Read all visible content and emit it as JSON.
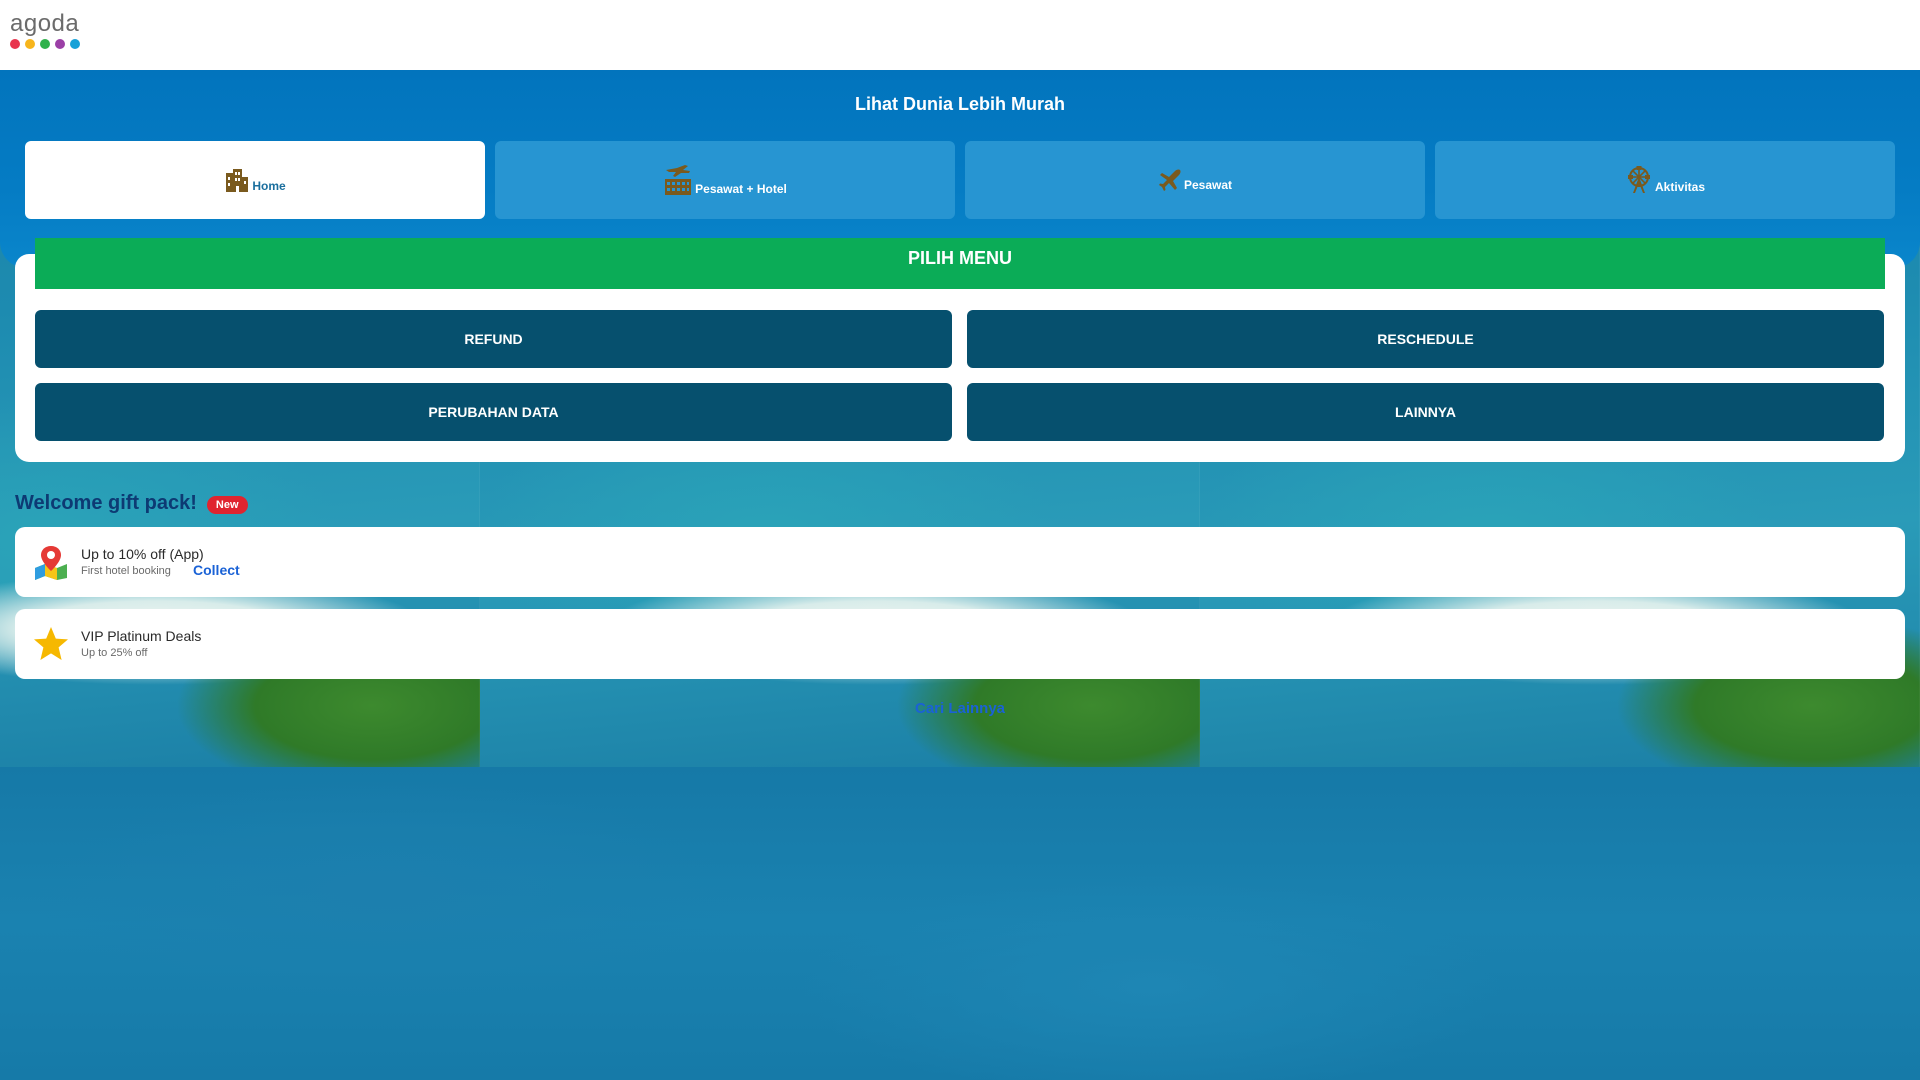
{
  "header": {
    "logo_text": "agoda",
    "logo_dot_colors": [
      "#e8344d",
      "#f7b51c",
      "#2fb14b",
      "#9b3fa6",
      "#16a1d8"
    ]
  },
  "banner": {
    "title": "Lihat Dunia Lebih Murah",
    "tabs": [
      {
        "label": "Home",
        "icon": "hotel-building-icon",
        "active": true
      },
      {
        "label": "Pesawat + Hotel",
        "icon": "flight-hotel-icon",
        "active": false
      },
      {
        "label": "Pesawat",
        "icon": "airplane-icon",
        "active": false
      },
      {
        "label": "Aktivitas",
        "icon": "ferris-wheel-icon",
        "active": false
      }
    ]
  },
  "menu": {
    "header": "PILIH MENU",
    "buttons": [
      "REFUND",
      "RESCHEDULE",
      "PERUBAHAN DATA",
      "LAINNYA"
    ]
  },
  "welcome": {
    "title": "Welcome gift pack!",
    "badge": "New",
    "deals": [
      {
        "title": "Up to 10% off (App)",
        "subtitle": "First hotel booking",
        "action": "Collect",
        "icon": "map-pin-icon"
      },
      {
        "title": "VIP Platinum Deals",
        "subtitle": "Up to 25% off",
        "icon": "star-icon"
      }
    ],
    "more_link": "Cari Lainnya"
  },
  "colors": {
    "banner_blue": "#0274bd",
    "menu_green": "#0bac57",
    "menu_button": "#06506e",
    "badge_red": "#e0242f",
    "link_blue": "#1a62d6",
    "icon_brown": "#7a5a1e"
  }
}
